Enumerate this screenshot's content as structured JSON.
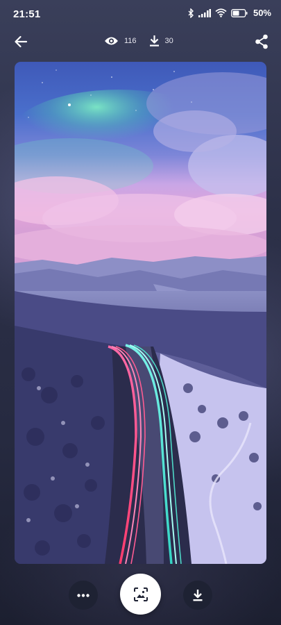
{
  "status_bar": {
    "time": "21:51",
    "battery": "50%",
    "icons": [
      "bluetooth-icon",
      "signal-icon",
      "wifi-icon",
      "battery-icon"
    ]
  },
  "top_bar": {
    "views_count": "116",
    "downloads_count": "30",
    "icons": [
      "back-arrow-icon",
      "eye-icon",
      "download-icon",
      "share-icon"
    ]
  },
  "wallpaper": {
    "subject": "aerial winter road with light trails under aurora sky"
  },
  "bottom_bar": {
    "icons": [
      "more-dots-icon",
      "set-wallpaper-icon",
      "download-icon"
    ]
  },
  "colors": {
    "background": "#2c3048",
    "button_dark": "#1e2233",
    "button_light": "#ffffff"
  }
}
